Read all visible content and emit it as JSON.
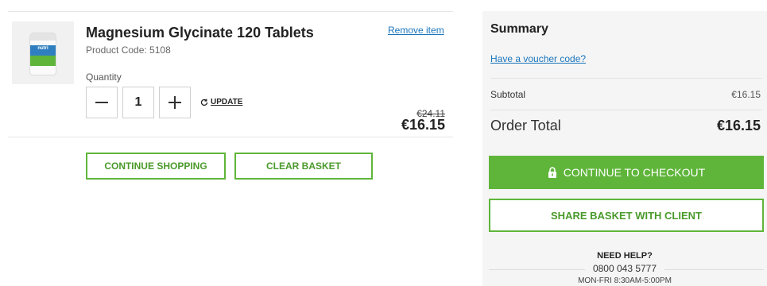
{
  "item": {
    "title": "Magnesium Glycinate 120 Tablets",
    "product_code": "Product Code: 5108",
    "remove_label": "Remove item",
    "quantity_label": "Quantity",
    "quantity_value": "1",
    "update_label": "UPDATE",
    "price_old": "€24.11",
    "price_new": "€16.15",
    "thumbnail_brand": "nutri"
  },
  "actions": {
    "continue_shopping": "CONTINUE SHOPPING",
    "clear_basket": "CLEAR BASKET"
  },
  "summary": {
    "title": "Summary",
    "voucher_label": "Have a voucher code?",
    "subtotal_label": "Subtotal",
    "subtotal_value": "€16.15",
    "total_label": "Order Total",
    "total_value": "€16.15",
    "checkout_label": "CONTINUE TO CHECKOUT",
    "share_label": "SHARE BASKET WITH CLIENT"
  },
  "help": {
    "title": "NEED HELP?",
    "phone": "0800 043 5777",
    "hours": "MON-FRI 8:30AM-5:00PM"
  },
  "icons": {
    "minus": "minus-icon",
    "plus": "plus-icon",
    "refresh": "refresh-icon",
    "lock": "lock-icon"
  },
  "colors": {
    "accent_green": "#5fb53a",
    "link_blue": "#1b75bc"
  }
}
